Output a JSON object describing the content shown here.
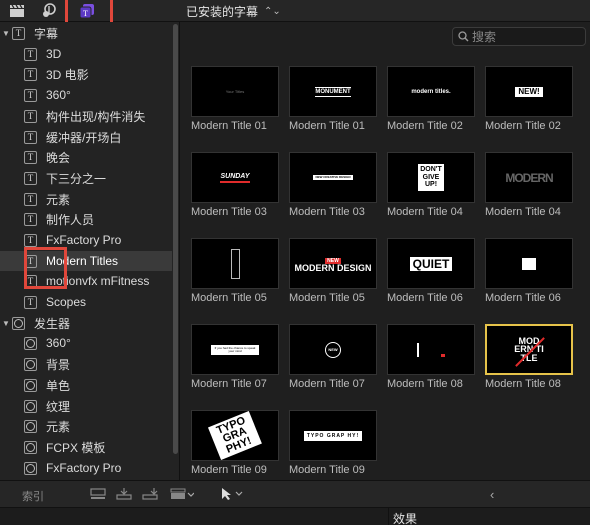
{
  "toolbar": {
    "browser_title": "已安装的字幕",
    "icons": [
      "clapper-icon",
      "photos-music-icon",
      "titles-generators-icon"
    ]
  },
  "search": {
    "placeholder": "搜索"
  },
  "sidebar": {
    "titles_group": "字幕",
    "title_items": [
      "3D",
      "3D 电影",
      "360°",
      "构件出现/构件消失",
      "缓冲器/开场白",
      "晚会",
      "下三分之一",
      "元素",
      "制作人员",
      "FxFactory Pro",
      "Modern Titles",
      "motionvfx mFitness",
      "Scopes"
    ],
    "generators_group": "发生器",
    "generator_items": [
      "360°",
      "背景",
      "单色",
      "纹理",
      "元素",
      "FCPX 模板",
      "FxFactory Pro"
    ],
    "selected": "Modern Titles"
  },
  "clips": [
    {
      "name": "Modern Title 01",
      "art": "Your Titles"
    },
    {
      "name": "Modern Title 01",
      "art": "MONUMENT"
    },
    {
      "name": "Modern Title 02",
      "art": "modern titles."
    },
    {
      "name": "Modern Title 02",
      "art": "NEW!"
    },
    {
      "name": "Modern Title 03",
      "art": "SUNDAY"
    },
    {
      "name": "Modern Title 03",
      "art": "NEW CREATIVE DESIGN"
    },
    {
      "name": "Modern Title 04",
      "art": "DON'T GIVE UP!"
    },
    {
      "name": "Modern Title 04",
      "art": "MODERN"
    },
    {
      "name": "Modern Title 05",
      "art": ""
    },
    {
      "name": "Modern Title 05",
      "art": "MODERN DESIGN"
    },
    {
      "name": "Modern Title 06",
      "art": "QUIET"
    },
    {
      "name": "Modern Title 06",
      "art": ""
    },
    {
      "name": "Modern Title 07",
      "art": "If you had the chance to speak your mind"
    },
    {
      "name": "Modern Title 07",
      "art": "NEW"
    },
    {
      "name": "Modern Title 08",
      "art": ""
    },
    {
      "name": "Modern Title 08",
      "art": "MOD ERN TI TLE"
    },
    {
      "name": "Modern Title 09",
      "art": "TYPO GRA PHY!"
    },
    {
      "name": "Modern Title 09",
      "art": "TYPO GRAP HY!"
    }
  ],
  "bottom": {
    "index_label": "索引",
    "effects_label": "效果"
  },
  "colors": {
    "highlight_box": "#e0473b",
    "selection_border": "#e6c34a",
    "accent_red": "#e02b2b"
  }
}
